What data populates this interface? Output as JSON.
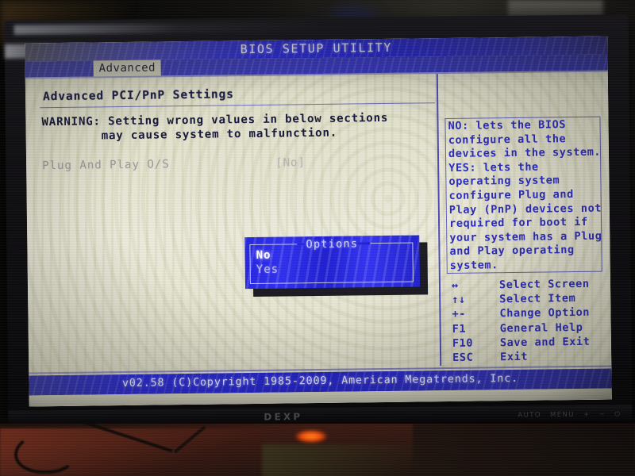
{
  "screen": {
    "title": "BIOS SETUP UTILITY",
    "active_tab": "Advanced",
    "section_title": "Advanced PCI/PnP Settings",
    "warning_line1": "WARNING: Setting wrong values in below sections",
    "warning_line2": "may cause system to malfunction.",
    "settings": [
      {
        "label": "Plug And Play O/S",
        "value": "[No]"
      }
    ],
    "footer": "v02.58 (C)Copyright 1985-2009, American Megatrends, Inc."
  },
  "dialog": {
    "title": "Options",
    "options": [
      {
        "label": "No",
        "selected": true
      },
      {
        "label": "Yes",
        "selected": false
      }
    ]
  },
  "help": {
    "lines": [
      "NO: lets the BIOS",
      "configure all the",
      "devices in the system.",
      "YES: lets the",
      "operating system",
      "configure Plug and",
      "Play (PnP) devices not",
      "required for boot if",
      "your system has a Plug",
      "and Play operating",
      "system."
    ],
    "legend": [
      {
        "key": "↔",
        "desc": "Select Screen"
      },
      {
        "key": "↑↓",
        "desc": "Select Item"
      },
      {
        "key": "+-",
        "desc": "Change Option"
      },
      {
        "key": "F1",
        "desc": "General Help"
      },
      {
        "key": "F10",
        "desc": "Save and Exit"
      },
      {
        "key": "ESC",
        "desc": "Exit"
      }
    ]
  },
  "monitor": {
    "brand": "DEXP",
    "osd_buttons": [
      "AUTO",
      "MENU",
      "+",
      "−",
      "⏻"
    ]
  },
  "colors": {
    "header_blue": "#2323d8",
    "screen_cream": "#e6e4d2",
    "bios_text_blue": "#2b2bc0",
    "dialog_blue": "#2626e0",
    "tab_highlight": "#c8c8b8",
    "led_orange": "#f4520c"
  }
}
